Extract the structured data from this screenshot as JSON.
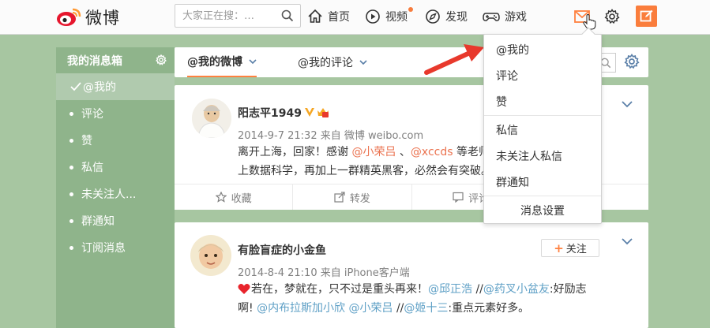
{
  "header": {
    "logo_text": "微博",
    "search_placeholder": "大家正在搜：…",
    "nav": [
      {
        "label": "首页",
        "icon": "home-icon"
      },
      {
        "label": "视频",
        "icon": "video-icon"
      },
      {
        "label": "发现",
        "icon": "discover-icon"
      },
      {
        "label": "游戏",
        "icon": "game-icon"
      }
    ],
    "accent_color": "#ff8140"
  },
  "sidebar": {
    "title": "我的消息箱",
    "items": [
      {
        "label": "@我的",
        "active": true
      },
      {
        "label": "评论"
      },
      {
        "label": "赞"
      },
      {
        "label": "私信"
      },
      {
        "label": "未关注人..."
      },
      {
        "label": "群通知"
      },
      {
        "label": "订阅消息"
      }
    ]
  },
  "tabs": [
    {
      "label": "@我的微博",
      "active": true
    },
    {
      "label": "@我的评论"
    }
  ],
  "posts": [
    {
      "user": "阳志平1949",
      "meta": "2014-9-7 21:32 来自 微博 weibo.com",
      "line1_a": "离开上海，回家！感谢 ",
      "line1_at1": "@小荣吕",
      "line1_b": " 、",
      "line1_at2": "@xccds",
      "line1_c": " 等老师的付出，多年前的好友都来了，聊聊，学遇",
      "line2": "上数据科学，再加上一群精英黑客，必然会有突破。",
      "actions": [
        "收藏",
        "转发",
        "评论"
      ]
    },
    {
      "user": "有脸盲症的小金鱼",
      "meta": "2014-8-4 21:10 来自 iPhone客户端",
      "follow_label": "关注",
      "line1_a": "若在，梦就在，只不过是重头再来！",
      "line1_at1": "@邱正浩",
      "line1_b": " //",
      "line1_at2": "@药叉小盆友",
      "line1_c": ":好励志",
      "line2_a": "啊! ",
      "line2_at1": "@内布拉斯加小欣",
      "line2_b": " ",
      "line2_at2": "@小荣吕",
      "line2_c": " //",
      "line2_at3": "@姬十三",
      "line2_d": ":重点元素好多。"
    }
  ],
  "dropdown": {
    "items": [
      "@我的",
      "评论",
      "赞",
      "私信",
      "未关注人私信",
      "群通知"
    ],
    "settings_label": "消息设置"
  }
}
